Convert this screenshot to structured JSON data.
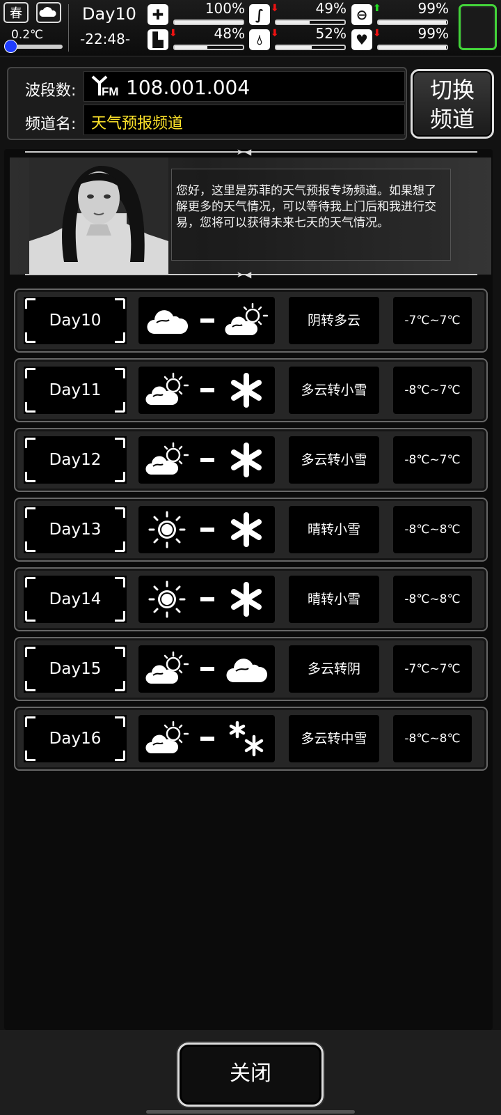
{
  "hud": {
    "season": "春",
    "temperature": "0.2℃",
    "temperature_level": 0.1,
    "day": "Day10",
    "time": "-22:48-",
    "stats": {
      "health": {
        "value": "100%",
        "fill": 1.0,
        "trend": ""
      },
      "hunger": {
        "value": "49%",
        "fill": 0.49,
        "trend": "down"
      },
      "sanity": {
        "value": "99%",
        "fill": 0.99,
        "trend": "up"
      },
      "stamina": {
        "value": "48%",
        "fill": 0.48,
        "trend": "down"
      },
      "thirst": {
        "value": "52%",
        "fill": 0.52,
        "trend": "down"
      },
      "heart": {
        "value": "99%",
        "fill": 0.99,
        "trend": "down"
      }
    },
    "accent_color": "#43d43a"
  },
  "channel": {
    "frequency_label": "波段数:",
    "frequency_value": "108.001.004",
    "name_label": "频道名:",
    "name_value": "天气预报频道",
    "name_color": "#ffe42a",
    "switch_button_line1": "切换",
    "switch_button_line2": "频道"
  },
  "intro": {
    "text": "您好，这里是苏菲的天气预报专场频道。如果想了解更多的天气情况，可以等待我上门后和我进行交易，您将可以获得未来七天的天气情况。"
  },
  "forecast": [
    {
      "day": "Day10",
      "icon_a": "cloud-icon",
      "icon_b": "partly-cloudy-icon",
      "desc": "阴转多云",
      "temp": "-7℃~7℃"
    },
    {
      "day": "Day11",
      "icon_a": "partly-cloudy-icon",
      "icon_b": "snow-icon",
      "desc": "多云转小雪",
      "temp": "-8℃~7℃"
    },
    {
      "day": "Day12",
      "icon_a": "partly-cloudy-icon",
      "icon_b": "snow-icon",
      "desc": "多云转小雪",
      "temp": "-8℃~7℃"
    },
    {
      "day": "Day13",
      "icon_a": "sun-icon",
      "icon_b": "snow-icon",
      "desc": "晴转小雪",
      "temp": "-8℃~8℃"
    },
    {
      "day": "Day14",
      "icon_a": "sun-icon",
      "icon_b": "snow-icon",
      "desc": "晴转小雪",
      "temp": "-8℃~8℃"
    },
    {
      "day": "Day15",
      "icon_a": "partly-cloudy-icon",
      "icon_b": "cloud-icon",
      "desc": "多云转阴",
      "temp": "-7℃~7℃"
    },
    {
      "day": "Day16",
      "icon_a": "partly-cloudy-icon",
      "icon_b": "moderate-snow-icon",
      "desc": "多云转中雪",
      "temp": "-8℃~8℃"
    }
  ],
  "close_button": "关闭"
}
